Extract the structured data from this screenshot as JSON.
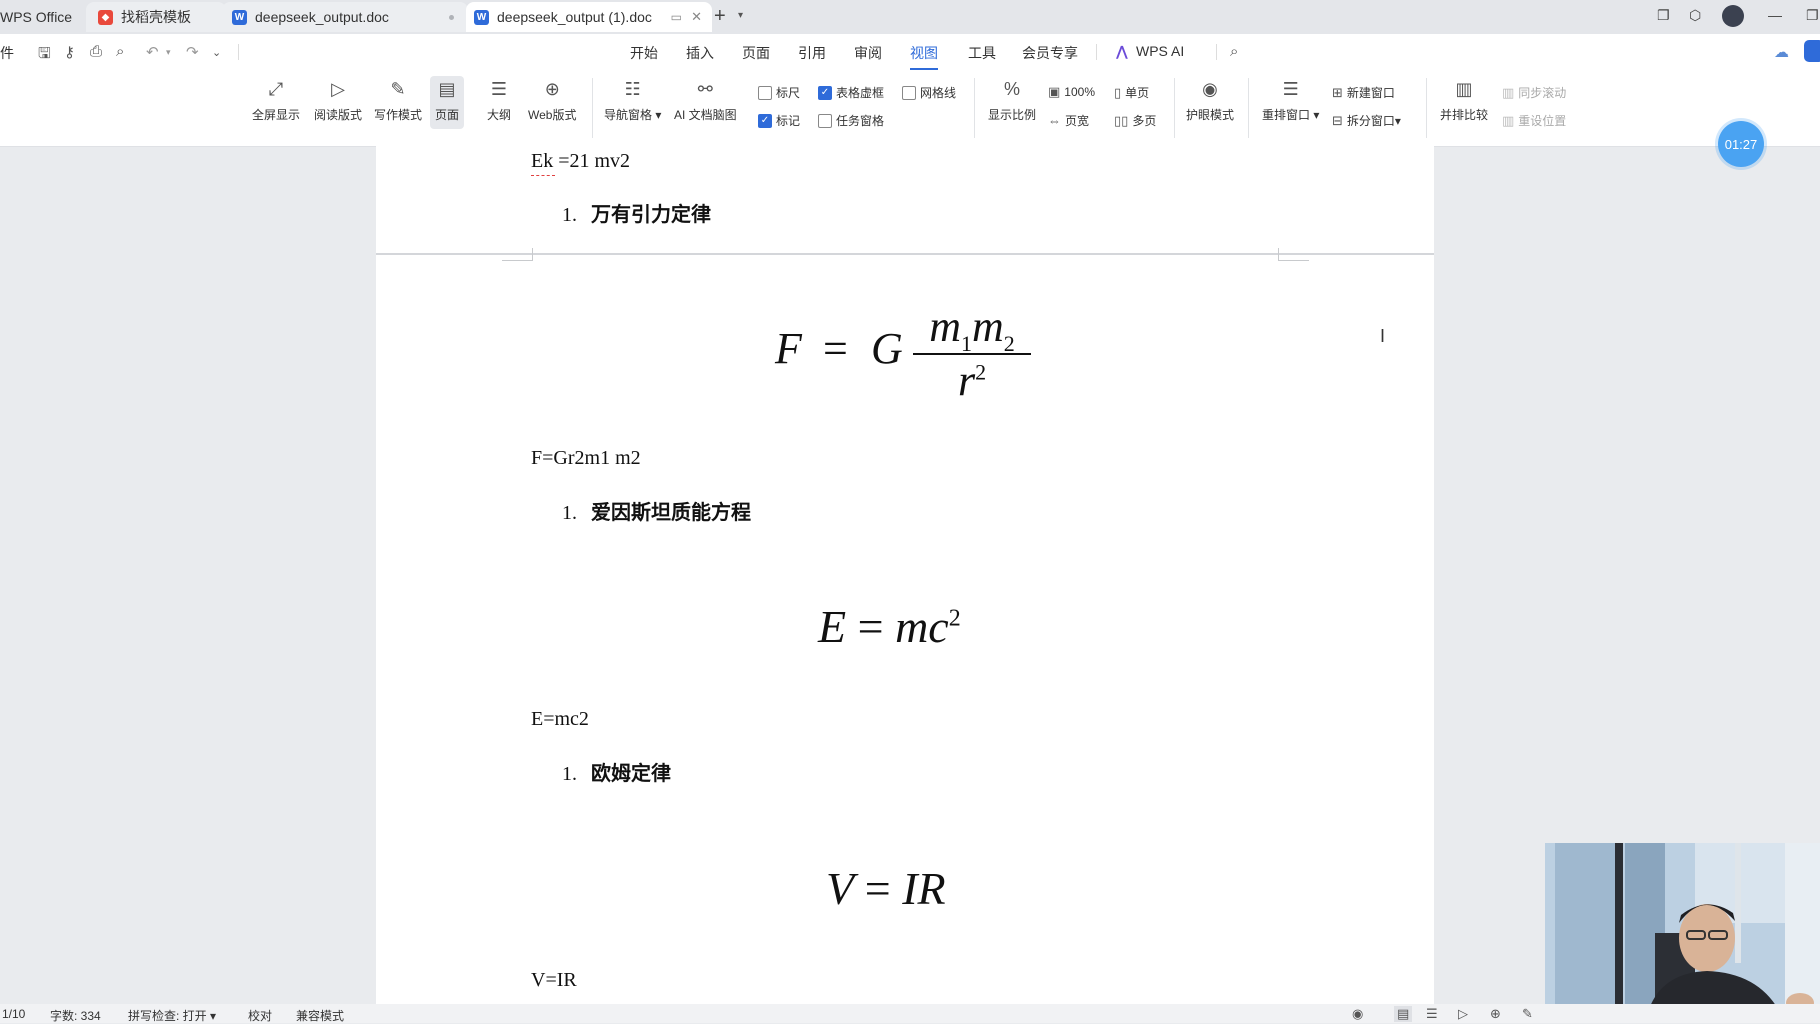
{
  "tabs": [
    {
      "label": "WPS Office",
      "icon": "wps-logo-icon"
    },
    {
      "label": "找稻壳模板",
      "icon": "docer-icon"
    },
    {
      "label": "deepseek_output.doc",
      "icon": "word-doc-icon"
    },
    {
      "label": "deepseek_output (1).doc",
      "icon": "word-doc-icon",
      "active": true
    }
  ],
  "menu": {
    "file_label": "件",
    "items": [
      "开始",
      "插入",
      "页面",
      "引用",
      "审阅",
      "视图",
      "工具",
      "会员专享",
      "WPS AI"
    ],
    "active": "视图"
  },
  "ribbon": {
    "fullscreen": "全屏显示",
    "reading": "阅读版式",
    "writing": "写作模式",
    "page": "页面",
    "outline": "大纲",
    "web": "Web版式",
    "nav_pane": "导航窗格",
    "ai_mindmap": "AI 文档脑图",
    "ruler": "标尺",
    "table_gridlines": "表格虚框",
    "gridlines": "网格线",
    "marks": "标记",
    "task_pane": "任务窗格",
    "zoom": "显示比例",
    "zoom_100": "100%",
    "page_width": "页宽",
    "single_page": "单页",
    "multi_page": "多页",
    "eye_care": "护眼模式",
    "rearrange": "重排窗口",
    "new_window": "新建窗口",
    "split_window": "拆分窗口",
    "side_by_side": "并排比较",
    "sync_scroll": "同步滚动",
    "reset_position": "重设位置",
    "checkbox_states": {
      "ruler": false,
      "table_gridlines": true,
      "gridlines": false,
      "marks": true,
      "task_pane": false
    }
  },
  "timer": "01:27",
  "document": {
    "ek_line": "Ek   =21   mv2",
    "h1": {
      "num": "1.",
      "text": "万有引力定律"
    },
    "f_formula_plain": "F=Gr2m1   m2",
    "h2": {
      "num": "1.",
      "text": "爱因斯坦质能方程"
    },
    "e_formula_plain": "E=mc2",
    "h3": {
      "num": "1.",
      "text": "欧姆定律"
    },
    "v_formula_plain": "V=IR"
  },
  "status": {
    "page": "1/10",
    "words": "字数: 334",
    "spell": "拼写检查: 打开",
    "proof": "校对",
    "compat": "兼容模式"
  }
}
